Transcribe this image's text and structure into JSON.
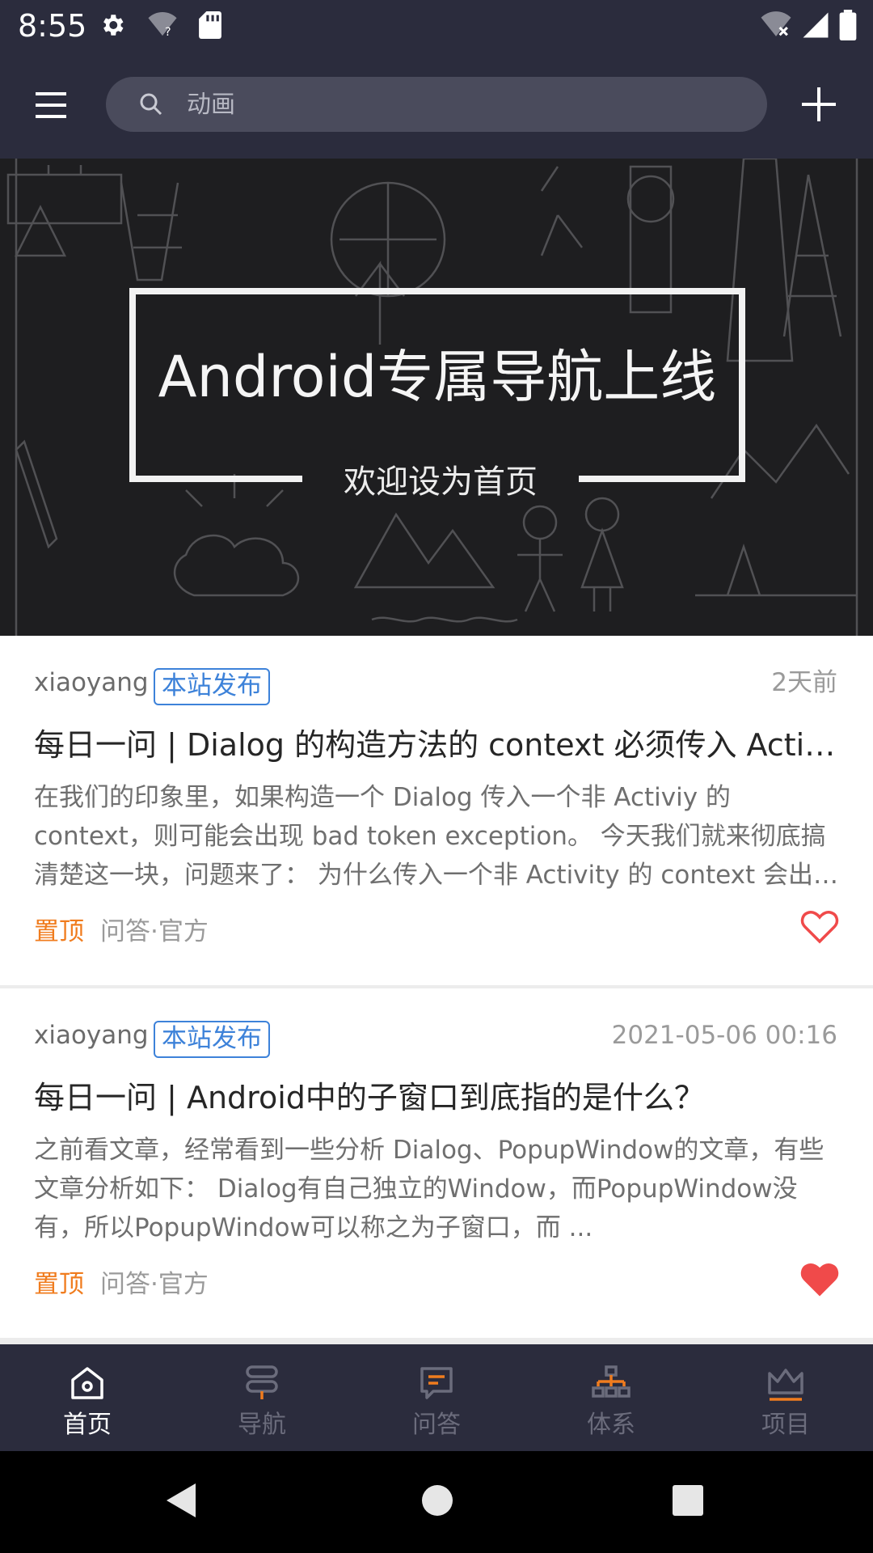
{
  "status_bar": {
    "time": "8:55",
    "icons": [
      "settings-icon",
      "wifi-question-icon",
      "sd-card-icon",
      "wifi-off-icon",
      "signal-icon",
      "battery-icon"
    ]
  },
  "app_bar": {
    "search_placeholder": "动画",
    "icons": [
      "menu-icon",
      "search-icon",
      "add-icon"
    ]
  },
  "banner": {
    "title": "Android专属导航上线",
    "subtitle": "欢迎设为首页"
  },
  "articles": [
    {
      "author": "xiaoyang",
      "tag": "本站发布",
      "time": "2天前",
      "title": "每日一问 | Dialog 的构造方法的 context 必须传入 Activity吗？",
      "desc": "在我们的印象里，如果构造一个 Dialog 传入一个非 Activiy 的 context，则可能会出现 bad token exception。 今天我们就来彻底搞清楚这一块，问题来了： 为什么传入一个非 Activity 的 context 会出现错误？",
      "pin": "置顶",
      "chapter": "问答·官方",
      "favorited": false
    },
    {
      "author": "xiaoyang",
      "tag": "本站发布",
      "time": "2021-05-06 00:16",
      "title": "每日一问 | Android中的子窗口到底指的是什么？",
      "desc": "之前看文章，经常看到一些分析 Dialog、PopupWindow的文章，有些文章分析如下： Dialog有自己独立的Window，而PopupWindow没有，所以PopupWindow可以称之为子窗口，而 ...",
      "pin": "置顶",
      "chapter": "问答·官方",
      "favorited": true
    }
  ],
  "bottom_nav": {
    "items": [
      {
        "label": "首页",
        "icon": "home-icon",
        "active": true
      },
      {
        "label": "导航",
        "icon": "signpost-icon",
        "active": false
      },
      {
        "label": "问答",
        "icon": "chat-icon",
        "active": false
      },
      {
        "label": "体系",
        "icon": "hierarchy-icon",
        "active": false
      },
      {
        "label": "项目",
        "icon": "crown-icon",
        "active": false
      }
    ]
  },
  "colors": {
    "bar_bg": "#2b2c3d",
    "accent_orange": "#f07c1e",
    "tag_blue": "#3d82d9",
    "heart_red": "#f04a4a"
  }
}
